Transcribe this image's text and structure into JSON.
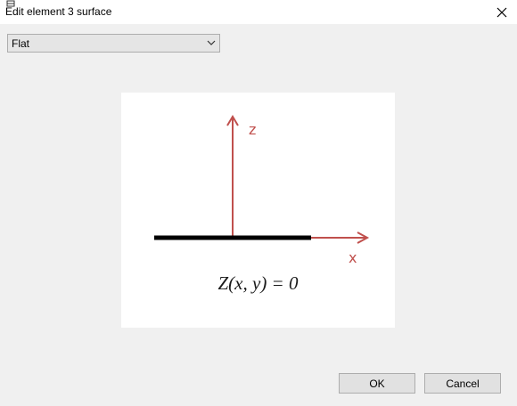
{
  "window": {
    "title": "Edit element 3 surface",
    "icons": {
      "app": "app-icon",
      "close": "close-icon"
    }
  },
  "surface_type": {
    "selected": "Flat",
    "icon": "chevron-down-icon"
  },
  "preview": {
    "z_label": "z",
    "x_label": "x",
    "formula": "Z(x, y) = 0",
    "colors": {
      "axis": "#c0504d",
      "surface": "#000000"
    }
  },
  "buttons": {
    "ok": "OK",
    "cancel": "Cancel"
  }
}
